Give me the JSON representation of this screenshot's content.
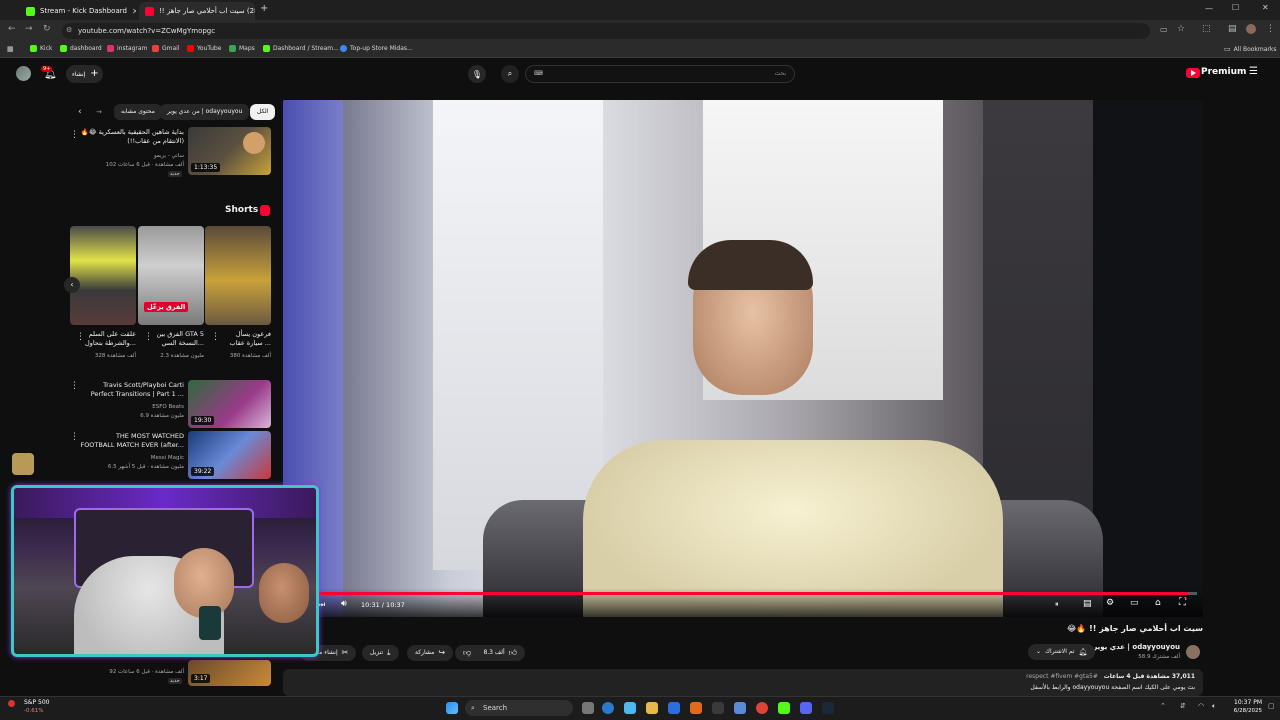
{
  "browser": {
    "tabs": [
      {
        "title": "Stream - Kick Dashboard",
        "color": "#53fc18",
        "active": false
      },
      {
        "title": "(2844) سيت اب أحلامي صار جاهز !!",
        "color": "#ff0033",
        "active": true
      }
    ],
    "url": "youtube.com/watch?v=ZCwMgYmopgc",
    "bookmarks": [
      {
        "label": "Kick",
        "color": "#53fc18"
      },
      {
        "label": "dashboard",
        "color": "#53fc18"
      },
      {
        "label": "instagram",
        "color": "#e1306c"
      },
      {
        "label": "Gmail",
        "color": "#ea4335"
      },
      {
        "label": "YouTube",
        "color": "#ff0000"
      },
      {
        "label": "Maps",
        "color": "#34a853"
      },
      {
        "label": "Dashboard / Stream...",
        "color": "#53fc18"
      },
      {
        "label": "Top-up Store Midas...",
        "color": "#4285f4"
      }
    ],
    "all_bookmarks": "All Bookmarks"
  },
  "header": {
    "create_label": "إنشاء",
    "notif_count": "9+",
    "search_placeholder": "بحث",
    "logo_text": "Premium"
  },
  "sidebar": {
    "chips": [
      "الكل",
      "من عدي يوير | odayyouyou",
      "محتوى مشابه"
    ],
    "videos_top": [
      {
        "title": "بداية شاهين الحقيقية بالعسكرية 😂🔥 (الانتقام من عقاب!!)",
        "channel": "ساتي - بريمو",
        "views": "102 ألف مشاهدة · قبل 6 ساعات",
        "badge": "جديد",
        "duration": "1:13:35"
      }
    ],
    "shorts_title": "Shorts",
    "shorts": [
      {
        "title": "فرعون يسأل سيارة عقاب ...",
        "views": "380 ألف مشاهدة"
      },
      {
        "title": "الفرق بين GTA 5 النسخة السي...",
        "views": "2.3 مليون مشاهدة",
        "overlay": "الفرق يزعّل"
      },
      {
        "title": "علقت على السلم والشرطة بتحاول...",
        "views": "328 ألف مشاهدة"
      }
    ],
    "videos_bottom": [
      {
        "title": "Travis Scott/Playboi Carti Perfect Transitions | Part 1 ...",
        "channel": "ESFO Beats",
        "views": "6.9 مليون مشاهدة",
        "duration": "19:30"
      },
      {
        "title": "THE MOST WATCHED FOOTBALL MATCH EVER (after...",
        "channel": "Messi Magic",
        "views": "6.5 مليون مشاهدة · قبل 5 أشهر",
        "duration": "39:22"
      },
      {
        "title": "",
        "channel": "",
        "views": "92 ألف مشاهدة · قبل 6 ساعات",
        "badge": "جديد",
        "duration": "3:17"
      }
    ]
  },
  "player": {
    "time": "10:31 / 10:37",
    "progress": 0.99
  },
  "video_info": {
    "title": "سيت اب أحلامي صار جاهز !! 🔥😂",
    "channel": "عدي يوير | odayyouyou",
    "subs": "58.9 ألف مشترك",
    "subscribed_label": "تم الاشتراك",
    "likes": "8.3 ألف",
    "share": "مشاركة",
    "download": "تنزيل",
    "clip": "إنشاء مقطع",
    "views_line": "37,011 مشاهدة قبل 4 ساعات",
    "hashtags": "#respect #fivem #gta5",
    "desc": "بث يومي على الكيك اسم الصفحة odayyouyou والرابط بالأسفل"
  },
  "taskbar": {
    "stock_name": "S&P 500",
    "stock_change": "-0.61%",
    "search_label": "Search",
    "time": "10:37 PM",
    "date": "6/28/2025"
  },
  "colors": {
    "accent_red": "#ff0033",
    "webcam_border": "#3fc7c7"
  }
}
